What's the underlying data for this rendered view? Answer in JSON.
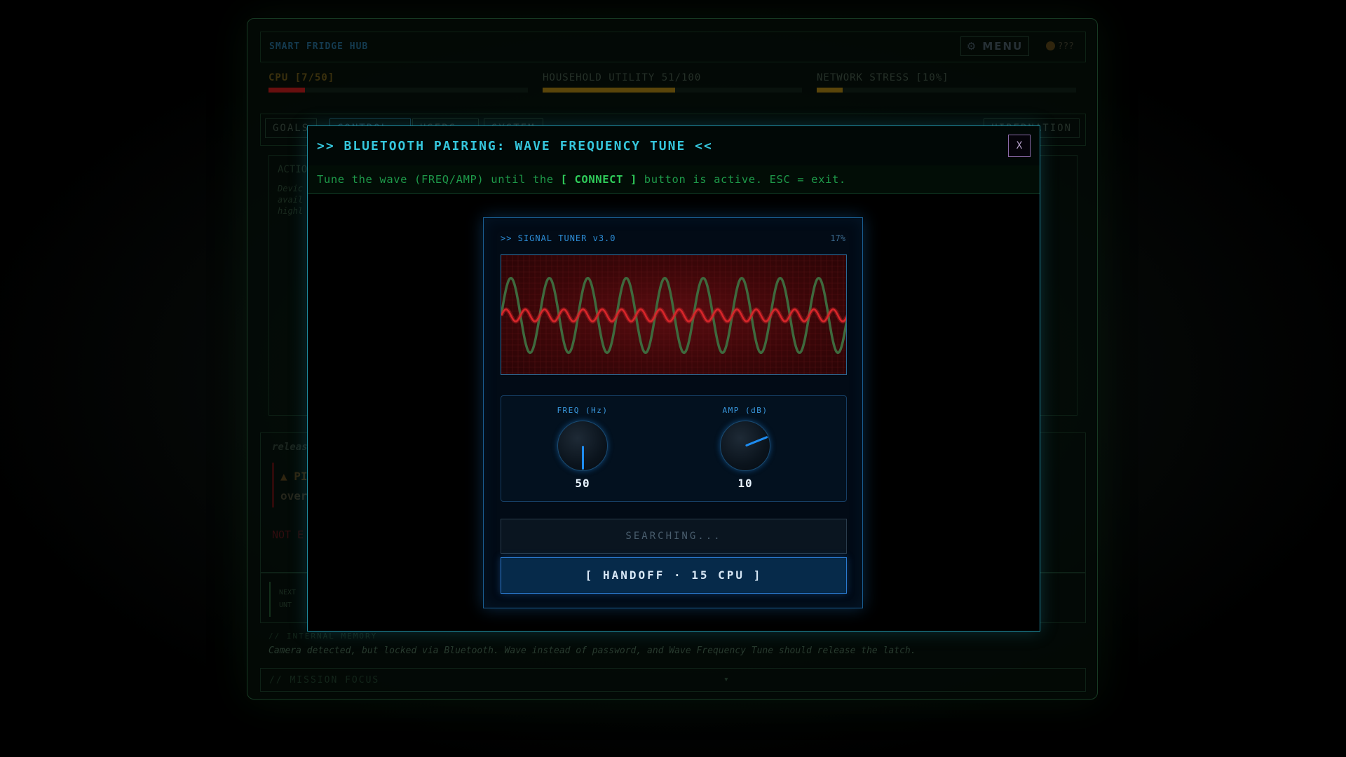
{
  "app": {
    "title": "SMART FRIDGE HUB",
    "menu_label": "⚙ MENU",
    "unknown_label": "???",
    "meters": [
      {
        "label": "CPU [7/50]",
        "fill": 0.14,
        "color": "#a01818"
      },
      {
        "label": "HOUSEHOLD UTILITY 51/100",
        "fill": 0.51,
        "color": "#8a6a10"
      },
      {
        "label": "NETWORK STRESS [10%]",
        "fill": 0.1,
        "color": "#8a6a10"
      }
    ],
    "tabs": [
      "GOALS",
      "CONTROL ▲",
      "USERS ▲",
      "SYSTEM"
    ],
    "hibernation_label": "HIBERNATION",
    "actions_heading": "ACTIO",
    "actions_desc": [
      "Devic",
      "avail",
      "highl"
    ],
    "release_text": "releas",
    "warning_lines": [
      "▲ PI",
      "over"
    ],
    "not_text": "NOT E",
    "next_lines": [
      "NEXT",
      "UNT"
    ],
    "memory_label": "// INTERNAL MEMORY",
    "memory_text": "Camera detected, but locked via Bluetooth. Wave instead of password, and Wave Frequency Tune should release the latch.",
    "mission_label": "// MISSION FOCUS",
    "mission_arrow": "▾"
  },
  "modal": {
    "title": ">> BLUETOOTH PAIRING: WAVE FREQUENCY TUNE <<",
    "close_label": "X",
    "instruction_before": "Tune the wave (FREQ/AMP) until the ",
    "instruction_strong": "[ CONNECT ]",
    "instruction_after": " button is active. ESC = exit."
  },
  "tuner": {
    "title": ">> SIGNAL TUNER v3.0",
    "percent": "17%",
    "freq_label": "FREQ (Hz)",
    "freq_value": "50",
    "amp_label": "AMP (dB)",
    "amp_value": "10",
    "status": "SEARCHING...",
    "handoff_label": "[ HANDOFF · 15 CPU ]",
    "target_wave": {
      "cycles": 9,
      "amplitude": 0.62,
      "color": "#3e6a3e"
    },
    "current_wave": {
      "cycles": 18,
      "amplitude": 0.1,
      "color": "#d8262a"
    }
  }
}
